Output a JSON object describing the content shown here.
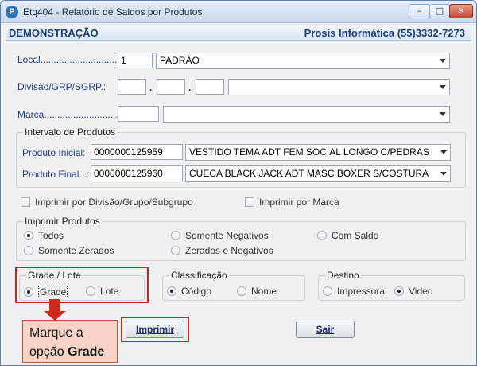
{
  "window": {
    "title": "Etq404 - Relatório de Saldos por Produtos",
    "min_glyph": "–",
    "max_glyph": "□",
    "close_glyph": "✕",
    "app_icon": "P"
  },
  "banner": {
    "left": "DEMONSTRAÇÃO",
    "right": "Prosis Informática (55)3332-7273"
  },
  "form": {
    "local_label": "Local.................................:",
    "local_code": "1",
    "local_name": "PADRÃO",
    "divisao_label": "Divisão/GRP/SGRP.:",
    "divisao_sep": ".",
    "divisao_fields": [
      "",
      "",
      ""
    ],
    "divisao_select": "",
    "marca_label": "Marca..............................:",
    "marca_code": "",
    "marca_select": ""
  },
  "intervalo": {
    "title": "Intervalo de Produtos",
    "inicial_label": "Produto Inicial:",
    "inicial_code": "0000000125959",
    "inicial_desc": "VESTIDO TEMA ADT FEM SOCIAL LONGO C/PEDRAS",
    "final_label": "Produto Final...:",
    "final_code": "0000000125960",
    "final_desc": "CUECA BLACK JACK ADT MASC BOXER S/COSTURA"
  },
  "checkboxes": {
    "divisao": "Imprimir por Divisão/Grupo/Subgrupo",
    "marca": "Imprimir por Marca"
  },
  "imprimir_produtos": {
    "title": "Imprimir Produtos",
    "options": [
      "Todos",
      "Somente Negativos",
      "Com Saldo",
      "Somente Zerados",
      "Zerados e Negativos"
    ],
    "selected": "Todos"
  },
  "grade_lote": {
    "title": "Grade / Lote",
    "options": [
      "Grade",
      "Lote"
    ],
    "selected": "Grade"
  },
  "classificacao": {
    "title": "Classificação",
    "options": [
      "Código",
      "Nome"
    ],
    "selected": "Código"
  },
  "destino": {
    "title": "Destino",
    "options": [
      "Impressora",
      "Video"
    ],
    "selected": "Video"
  },
  "buttons": {
    "imprimir": "Imprimir",
    "sair": "Sair"
  },
  "callout": {
    "line1": "Marque a",
    "line2_prefix": "opção ",
    "line2_bold": "Grade"
  },
  "colors": {
    "highlight": "#cc1f1f",
    "label_blue": "#223c8a",
    "callout_bg": "#f6d3c6"
  }
}
